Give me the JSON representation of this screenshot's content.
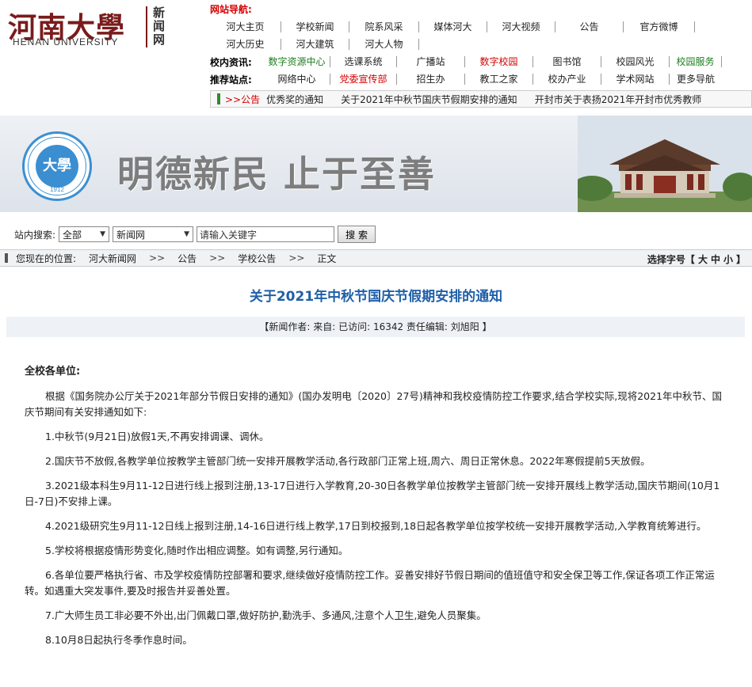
{
  "header": {
    "logo_cn": "河南大學",
    "logo_en": "HENAN UNIVERSITY",
    "logo_news": "新闻网"
  },
  "nav": {
    "title": "网站导航:",
    "row1": [
      "河大主页",
      "学校新闻",
      "院系风采",
      "媒体河大",
      "河大视频",
      "公告",
      "官方微博"
    ],
    "row2": [
      "河大历史",
      "河大建筑",
      "河大人物"
    ],
    "resources_label": "校内资讯:",
    "resources": [
      "数字资源中心",
      "选课系统",
      "广播站",
      "数字校园",
      "图书馆",
      "校园风光",
      "校园服务"
    ],
    "recommend_label": "推荐站点:",
    "recommend": [
      "网络中心",
      "党委宣传部",
      "招生办",
      "教工之家",
      "校办产业",
      "学术网站",
      "更多导航"
    ]
  },
  "ticker": {
    "label": ">>公告",
    "items": [
      "优秀奖的通知",
      "关于2021年中秋节国庆节假期安排的通知",
      "开封市关于表扬2021年开封市优秀教师"
    ]
  },
  "banner": {
    "slogan": "明德新民  止于至善",
    "seal_text": "HENAN UNIVERSITY",
    "seal_year": "1912",
    "seal_glyph": "大學"
  },
  "search": {
    "label": "站内搜索:",
    "scope": "全部",
    "category": "新闻网",
    "placeholder": "请输入关键字",
    "button": "搜 索"
  },
  "breadcrumb": {
    "prefix": "您现在的位置:",
    "items": [
      "河大新闻网",
      "公告",
      "学校公告",
      "正文"
    ],
    "sep": ">>",
    "fontsize_label": "选择字号【",
    "fontsize_options": [
      "大",
      "中",
      "小"
    ],
    "fontsize_close": "】"
  },
  "article": {
    "title": "关于2021年中秋节国庆节假期安排的通知",
    "meta": "【新闻作者:        来自:        已访问: 16342  责任编辑: 刘旭阳  】",
    "greeting": "全校各单位:",
    "paragraphs": [
      "根据《国务院办公厅关于2021年部分节假日安排的通知》(国办发明电〔2020〕27号)精神和我校疫情防控工作要求,结合学校实际,现将2021年中秋节、国庆节期间有关安排通知如下:",
      "1.中秋节(9月21日)放假1天,不再安排调课、调休。",
      "2.国庆节不放假,各教学单位按教学主管部门统一安排开展教学活动,各行政部门正常上班,周六、周日正常休息。2022年寒假提前5天放假。",
      "3.2021级本科生9月11-12日进行线上报到注册,13-17日进行入学教育,20-30日各教学单位按教学主管部门统一安排开展线上教学活动,国庆节期间(10月1日-7日)不安排上课。",
      "4.2021级研究生9月11-12日线上报到注册,14-16日进行线上教学,17日到校报到,18日起各教学单位按学校统一安排开展教学活动,入学教育统筹进行。",
      "5.学校将根据疫情形势变化,随时作出相应调整。如有调整,另行通知。",
      "6.各单位要严格执行省、市及学校疫情防控部署和要求,继续做好疫情防控工作。妥善安排好节假日期间的值班值守和安全保卫等工作,保证各项工作正常运转。如遇重大突发事件,要及时报告并妥善处置。",
      "7.广大师生员工非必要不外出,出门佩戴口罩,做好防护,勤洗手、多通风,注意个人卫生,避免人员聚集。",
      "8.10月8日起执行冬季作息时间。"
    ]
  },
  "colors": {
    "brand": "#7a1b1b",
    "nav_red": "#d40000",
    "nav_green": "#1e7d1e",
    "title_blue": "#1f5fa8"
  }
}
